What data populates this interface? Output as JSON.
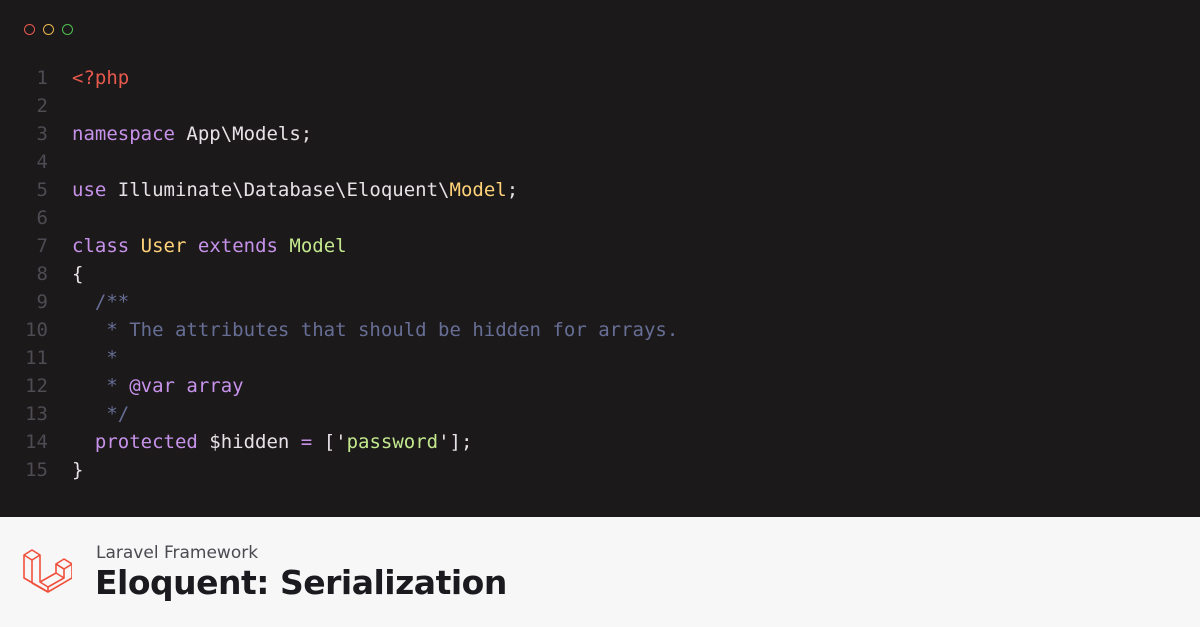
{
  "window_controls": {
    "colors": [
      "#e8594d",
      "#e8b64d",
      "#4fbf4f"
    ]
  },
  "code_lines": [
    {
      "n": "1",
      "segments": [
        {
          "t": "<?php",
          "c": "tag"
        }
      ]
    },
    {
      "n": "2",
      "segments": []
    },
    {
      "n": "3",
      "segments": [
        {
          "t": "namespace",
          "c": "kw"
        },
        {
          "t": " App\\Models;",
          "c": "plain"
        }
      ]
    },
    {
      "n": "4",
      "segments": []
    },
    {
      "n": "5",
      "segments": [
        {
          "t": "use",
          "c": "kw"
        },
        {
          "t": " Illuminate\\Database\\Eloquent\\",
          "c": "plain"
        },
        {
          "t": "Model",
          "c": "cls"
        },
        {
          "t": ";",
          "c": "plain"
        }
      ]
    },
    {
      "n": "6",
      "segments": []
    },
    {
      "n": "7",
      "segments": [
        {
          "t": "class",
          "c": "kw"
        },
        {
          "t": " ",
          "c": "plain"
        },
        {
          "t": "User",
          "c": "cls"
        },
        {
          "t": " ",
          "c": "plain"
        },
        {
          "t": "extends",
          "c": "kw"
        },
        {
          "t": " ",
          "c": "plain"
        },
        {
          "t": "Model",
          "c": "str"
        }
      ]
    },
    {
      "n": "8",
      "segments": [
        {
          "t": "{",
          "c": "plain"
        }
      ]
    },
    {
      "n": "9",
      "segments": [
        {
          "t": "  /**",
          "c": "cm"
        }
      ]
    },
    {
      "n": "10",
      "segments": [
        {
          "t": "   * The attributes that should be hidden for arrays.",
          "c": "cm"
        }
      ]
    },
    {
      "n": "11",
      "segments": [
        {
          "t": "   *",
          "c": "cm"
        }
      ]
    },
    {
      "n": "12",
      "segments": [
        {
          "t": "   * ",
          "c": "cm"
        },
        {
          "t": "@var",
          "c": "kw"
        },
        {
          "t": " ",
          "c": "cm"
        },
        {
          "t": "array",
          "c": "kw"
        }
      ]
    },
    {
      "n": "13",
      "segments": [
        {
          "t": "   */",
          "c": "cm"
        }
      ]
    },
    {
      "n": "14",
      "segments": [
        {
          "t": "  ",
          "c": "plain"
        },
        {
          "t": "protected",
          "c": "kw"
        },
        {
          "t": " $hidden ",
          "c": "plain"
        },
        {
          "t": "=",
          "c": "kw"
        },
        {
          "t": " ['",
          "c": "plain"
        },
        {
          "t": "password",
          "c": "str"
        },
        {
          "t": "'];",
          "c": "plain"
        }
      ]
    },
    {
      "n": "15",
      "segments": [
        {
          "t": "}",
          "c": "plain"
        }
      ]
    }
  ],
  "footer": {
    "subtitle": "Laravel Framework",
    "title": "Eloquent: Serialization",
    "logo_icon": "laravel-logo-icon",
    "logo_color": "#f0503b"
  }
}
